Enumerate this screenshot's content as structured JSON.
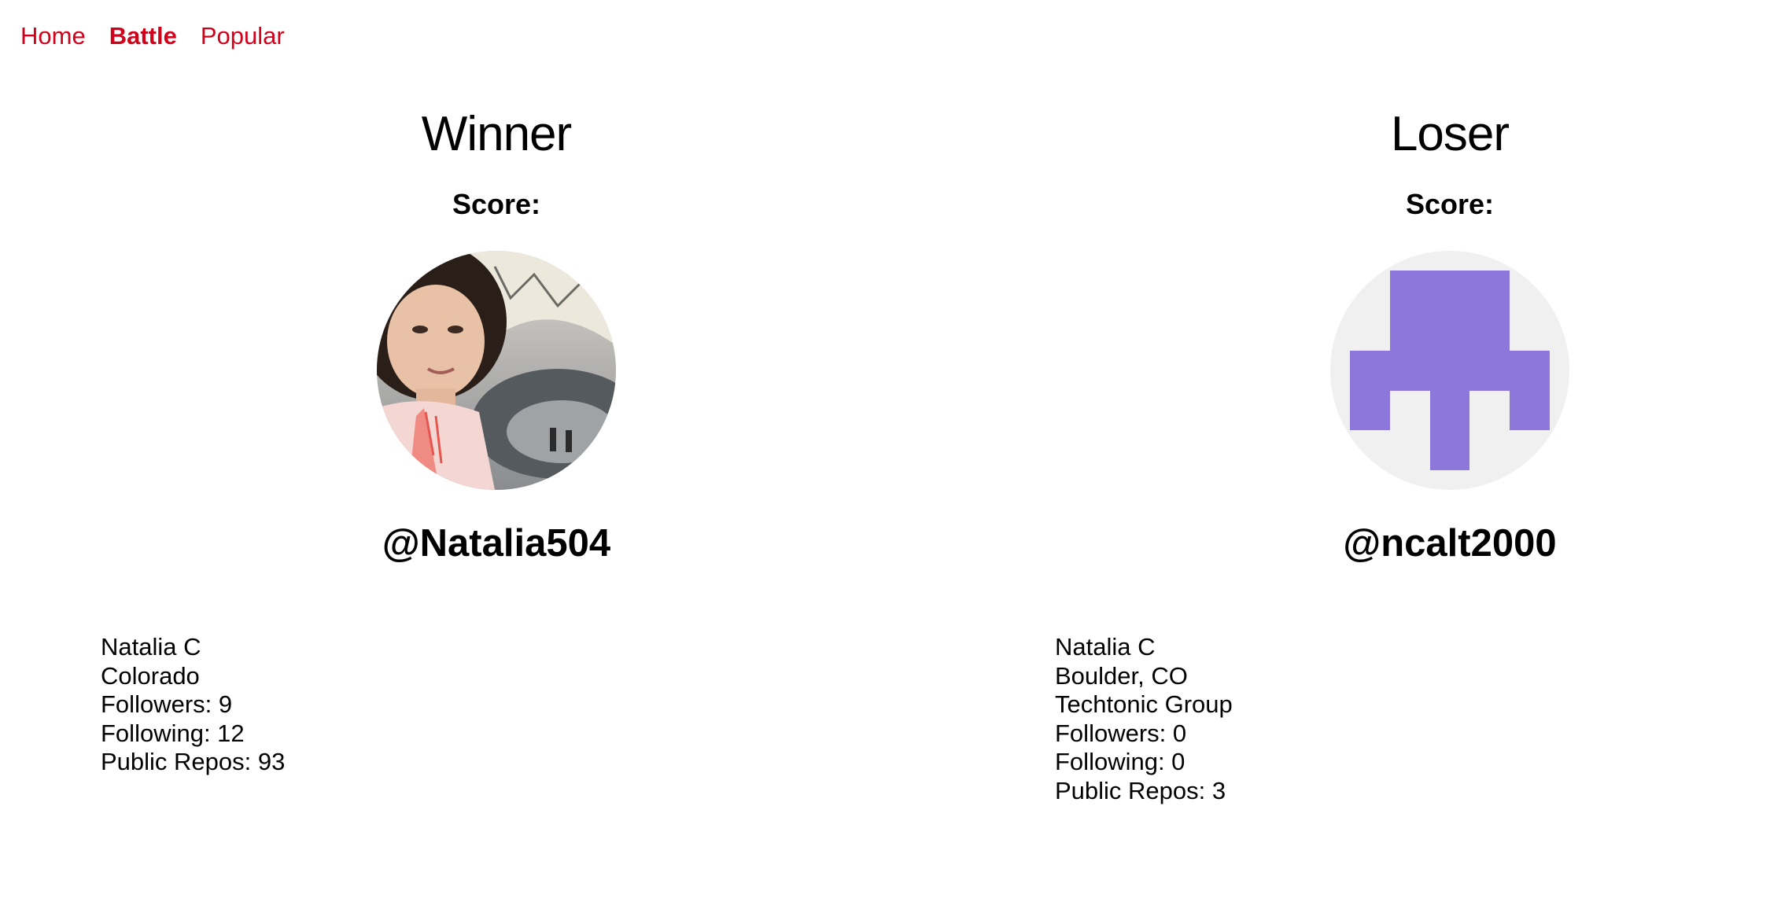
{
  "nav": {
    "items": [
      {
        "label": "Home",
        "active": false
      },
      {
        "label": "Battle",
        "active": true
      },
      {
        "label": "Popular",
        "active": false
      }
    ],
    "color": "#d0021b"
  },
  "players": [
    {
      "result": "Winner",
      "score_label": "Score:",
      "handle": "@Natalia504",
      "avatar": "photo-avatar",
      "info": [
        "Natalia C",
        "Colorado",
        "Followers: 9",
        "Following: 12",
        "Public Repos: 93"
      ]
    },
    {
      "result": "Loser",
      "score_label": "Score:",
      "handle": "@ncalt2000",
      "avatar": "identicon-avatar",
      "identicon_color": "#8e77db",
      "info": [
        "Natalia C",
        "Boulder, CO",
        "Techtonic Group",
        "Followers: 0",
        "Following: 0",
        "Public Repos: 3"
      ]
    }
  ]
}
